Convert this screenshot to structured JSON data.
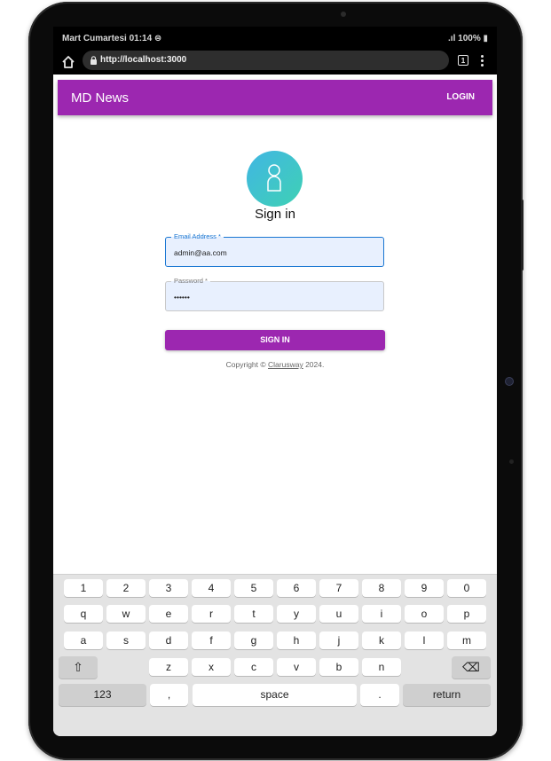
{
  "status": {
    "left_text": "Mart Cumartesi 01:14 ⊜",
    "right_text": ".ıl 100% ▮"
  },
  "browser": {
    "url": "http://localhost:3000",
    "tabs_count": "1"
  },
  "appbar": {
    "brand": "MD News",
    "login_label": "LOGIN"
  },
  "form": {
    "title": "Sign in",
    "email_label": "Email Address *",
    "email_value": "admin@aa.com",
    "password_label": "Password *",
    "password_value": "••••••",
    "submit_label": "SIGN IN",
    "copyright_prefix": "Copyright © ",
    "copyright_link": "Clarusway",
    "copyright_suffix": " 2024."
  },
  "keyboard": {
    "row1": [
      "1",
      "2",
      "3",
      "4",
      "5",
      "6",
      "7",
      "8",
      "9",
      "0"
    ],
    "row2": [
      "q",
      "w",
      "e",
      "r",
      "t",
      "y",
      "u",
      "i",
      "o",
      "p"
    ],
    "row3": [
      "a",
      "s",
      "d",
      "f",
      "g",
      "h",
      "j",
      "k",
      "l",
      "m"
    ],
    "row4": [
      "z",
      "x",
      "c",
      "v",
      "b",
      "n"
    ],
    "shift": "⇧",
    "backspace": "⌫",
    "num_label": "123",
    "comma": ",",
    "space_label": "space",
    "period": ".",
    "return_label": "return"
  },
  "colors": {
    "accent": "#9c27b0",
    "focus": "#1976d2",
    "autofill": "#e8f0fe"
  }
}
